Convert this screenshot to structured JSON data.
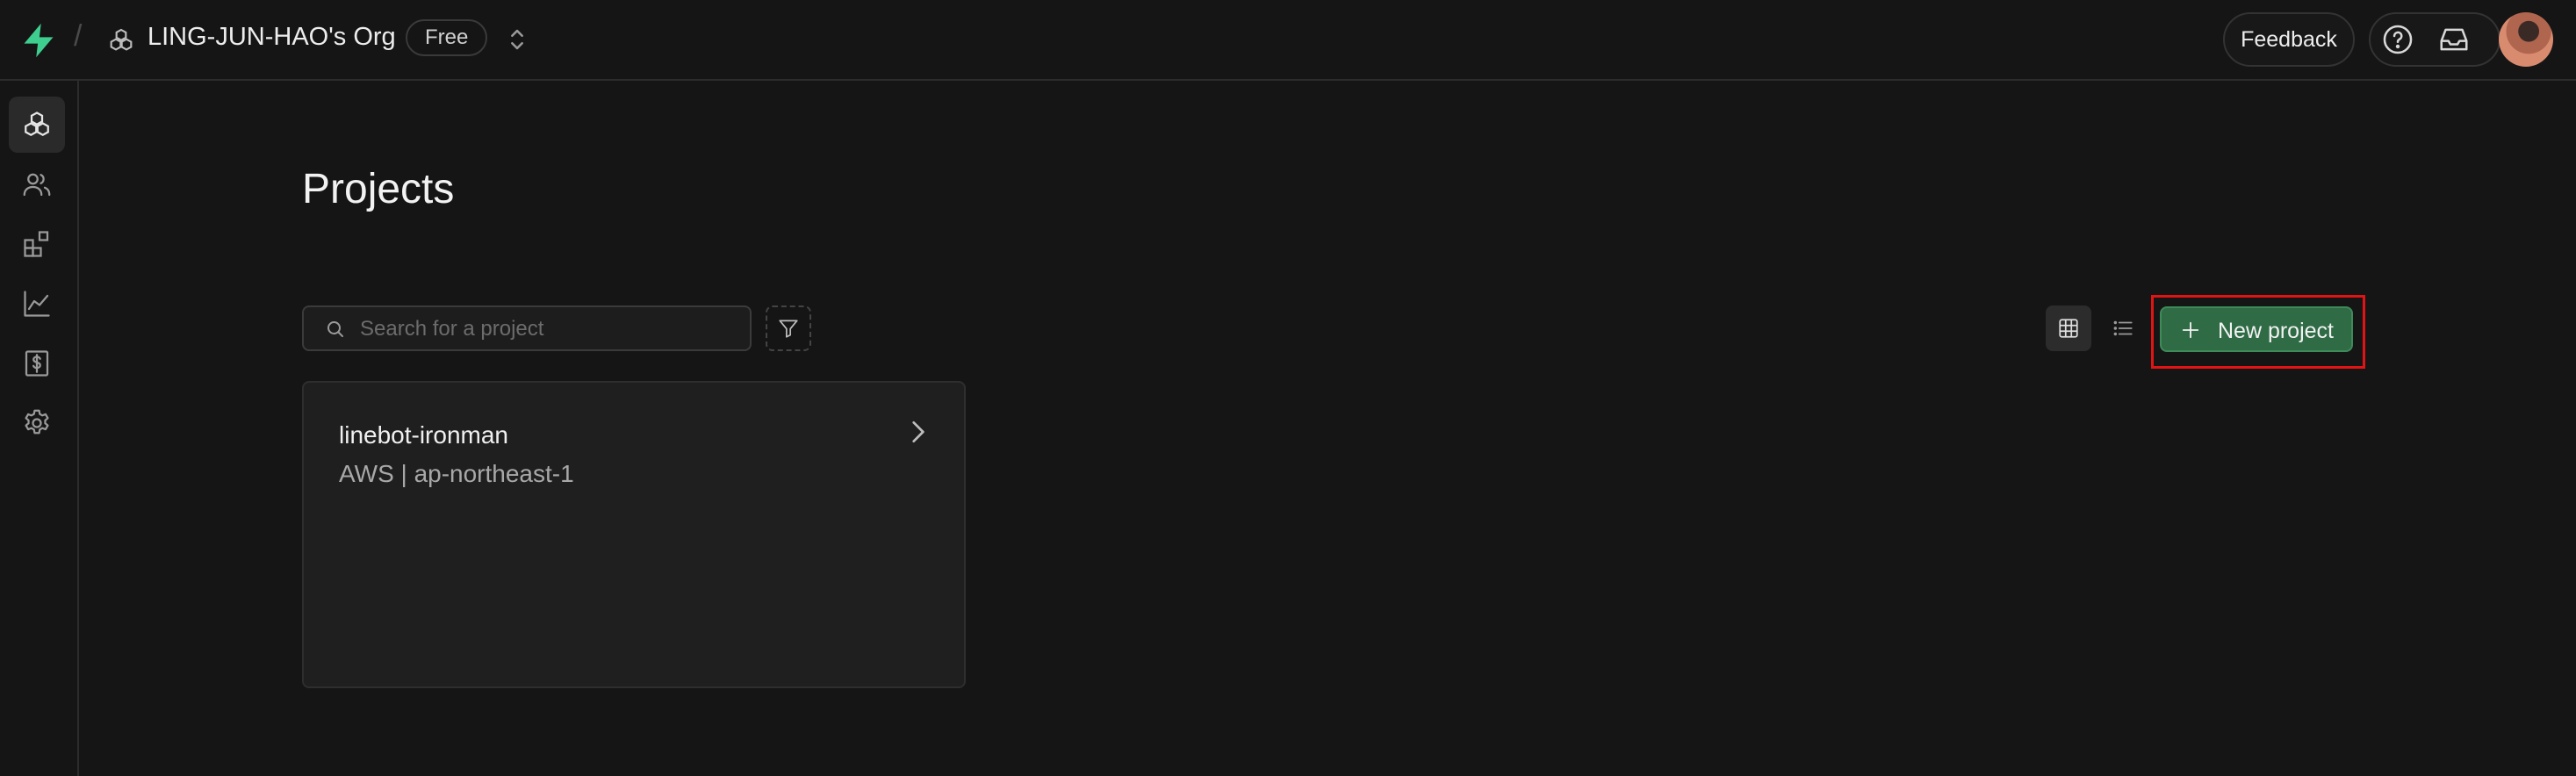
{
  "header": {
    "breadcrumb_separator": "/",
    "org_name": "LING-JUN-HAO's Org",
    "plan_badge": "Free",
    "feedback_label": "Feedback"
  },
  "sidebar": {
    "items": [
      {
        "icon": "projects-icon",
        "active": true
      },
      {
        "icon": "team-icon",
        "active": false
      },
      {
        "icon": "integrations-icon",
        "active": false
      },
      {
        "icon": "usage-icon",
        "active": false
      },
      {
        "icon": "billing-icon",
        "active": false
      },
      {
        "icon": "settings-icon",
        "active": false
      }
    ]
  },
  "main": {
    "title": "Projects",
    "search_placeholder": "Search for a project",
    "search_value": "",
    "new_project_label": "New project",
    "view_mode": "grid",
    "projects": [
      {
        "name": "linebot-ironman",
        "region": "AWS | ap-northeast-1"
      }
    ]
  },
  "colors": {
    "background": "#151515",
    "accent_green": "#2f6b45",
    "brand_green": "#3ecf8e",
    "highlight_red": "#e01414"
  }
}
